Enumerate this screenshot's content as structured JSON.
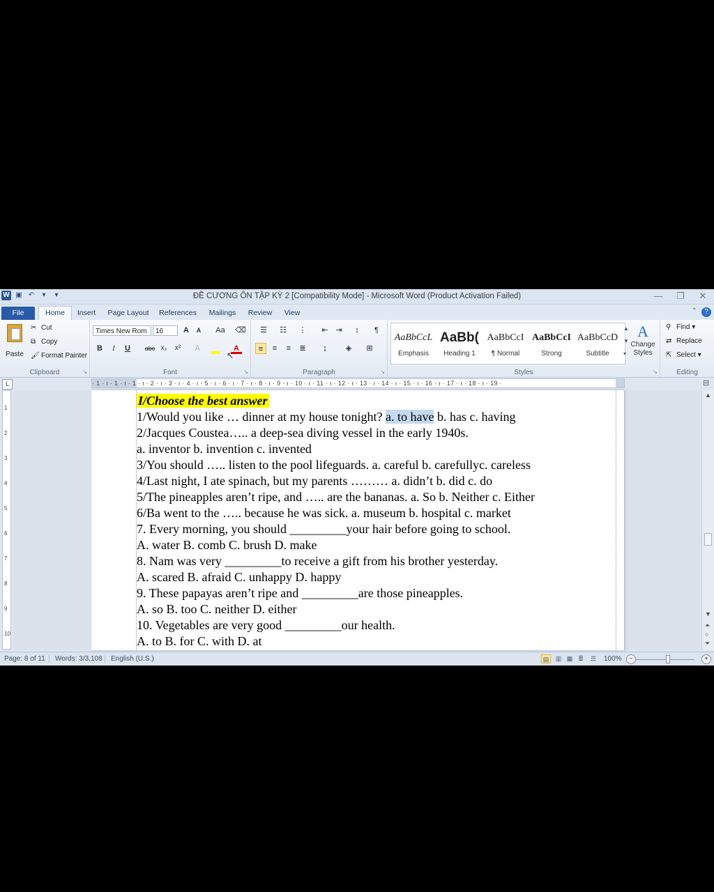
{
  "window": {
    "title": "ĐỀ CƯƠNG ÔN TẬP KỲ 2 [Compatibility Mode] - Microsoft Word (Product Activation Failed)",
    "app_icon": "W"
  },
  "tabs": [
    "File",
    "Home",
    "Insert",
    "Page Layout",
    "References",
    "Mailings",
    "Review",
    "View"
  ],
  "ribbon": {
    "clipboard": {
      "label": "Clipboard",
      "paste": "Paste",
      "cut": "Cut",
      "copy": "Copy",
      "format_painter": "Format Painter"
    },
    "font": {
      "label": "Font",
      "font_name": "Times New Rom",
      "font_size": "16",
      "grow": "A",
      "shrink": "A",
      "change_case": "Aa",
      "bold": "B",
      "italic": "I",
      "underline": "U",
      "strike": "abc",
      "subscript": "x₂",
      "superscript": "x²"
    },
    "paragraph": {
      "label": "Paragraph",
      "show_marks": "¶"
    },
    "styles": {
      "label": "Styles",
      "items": [
        {
          "sample": "AaBbCcL",
          "name": "Emphasis"
        },
        {
          "sample": "AaBb(",
          "name": "Heading 1"
        },
        {
          "sample": "AaBbCcI",
          "name": "¶ Normal"
        },
        {
          "sample": "AaBbCcI",
          "name": "Strong"
        },
        {
          "sample": "AaBbCcD",
          "name": "Subtitle"
        }
      ],
      "change_styles": "Change Styles"
    },
    "editing": {
      "label": "Editing",
      "find": "Find",
      "replace": "Replace",
      "select": "Select"
    }
  },
  "ruler": {
    "corner": "L",
    "ticks": "· 1 · ı · 1 · ı · 1 · ı · 2 · ı · 3 · ı · 4 · ı · 5 · ı · 6 · ı · 7 · ı · 8 · ı · 9 · ı · 10 · ı · 11 · ı · 12 · ı · 13 · ı · 14 · ı · 15 · ı · 16 · ı · 17 · ı · 18 · ı · 19 ·"
  },
  "document": {
    "heading": "I/Choose the best answer",
    "lines": [
      {
        "text": "1/Would you like … dinner at my house tonight?",
        "sel": "a. to have",
        "after": " b. has        c. having"
      },
      {
        "text": "2/Jacques Coustea….. a deep-sea diving vessel in the early 1940s."
      },
      {
        "text": "a. inventor          b. invention          c. invented"
      },
      {
        "text": "3/You should ….. listen to the pool lifeguards.          a. careful      b. carefullyc. careless"
      },
      {
        "text": "4/Last night, I ate spinach, but my parents ………    a. didn’t      b. did       c. do"
      },
      {
        "text": "5/The pineapples aren’t ripe, and ….. are the bananas.          a. So   b. Neither   c. Either"
      },
      {
        "text": "6/Ba went to the ….. because he was sick.           a. museum         b. hospital   c. market"
      },
      {
        "text": "7. Every morning, you should _________your hair before going to school."
      },
      {
        "text": "A. water                 B. comb              C. brush             D. make"
      },
      {
        "text": "8. Nam was very _________to receive a gift from his brother yesterday."
      },
      {
        "text": "A. scared                B. afraid             C. unhappy     D. happy"
      },
      {
        "text": "9. These papayas aren’t ripe and _________are those pineapples."
      },
      {
        "text": "A. so                      B. too                C. neither          D. either"
      },
      {
        "text": "10. Vegetables are very good _________our health."
      },
      {
        "text": "A. to                      B. for                C. with              D. at"
      }
    ]
  },
  "status": {
    "page": "Page: 8 of 11",
    "words": "Words: 3/3,108",
    "language": "English (U.S.)",
    "zoom": "100%",
    "zoom_level": 1.0
  }
}
